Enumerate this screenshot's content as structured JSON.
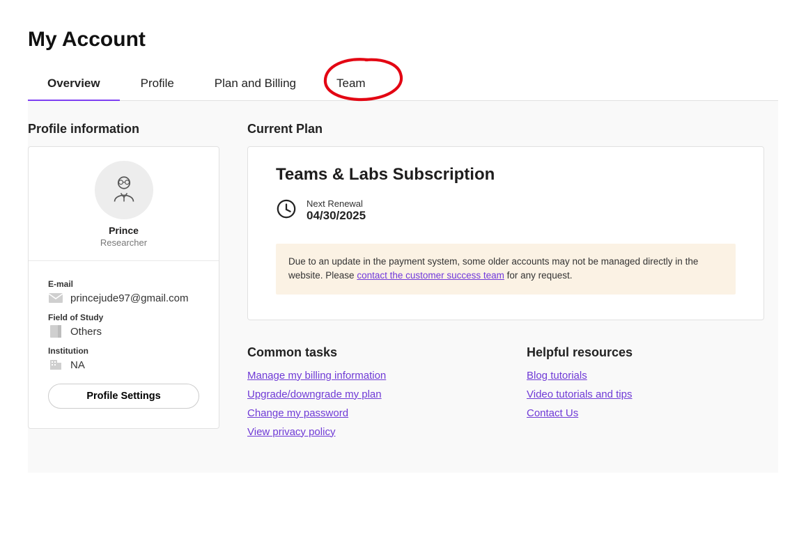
{
  "page_title": "My Account",
  "tabs": [
    {
      "label": "Overview",
      "active": true
    },
    {
      "label": "Profile",
      "active": false
    },
    {
      "label": "Plan and Billing",
      "active": false
    },
    {
      "label": "Team",
      "active": false
    }
  ],
  "profile_info": {
    "section_title": "Profile information",
    "name": "Prince",
    "role": "Researcher",
    "email_label": "E-mail",
    "email": "princejude97@gmail.com",
    "field_label": "Field of Study",
    "field_value": "Others",
    "institution_label": "Institution",
    "institution_value": "NA",
    "settings_button": "Profile Settings"
  },
  "current_plan": {
    "section_title": "Current Plan",
    "plan_name": "Teams & Labs Subscription",
    "renewal_label": "Next Renewal",
    "renewal_date": "04/30/2025",
    "alert_text_before": "Due to an update in the payment system, some older accounts may not be managed directly in the website. Please ",
    "alert_link": "contact the customer success team",
    "alert_text_after": " for any request."
  },
  "common_tasks": {
    "title": "Common tasks",
    "links": [
      "Manage my billing information",
      "Upgrade/downgrade my plan",
      "Change my password",
      "View privacy policy"
    ]
  },
  "helpful_resources": {
    "title": "Helpful resources",
    "links": [
      "Blog tutorials",
      "Video tutorials and tips",
      "Contact Us"
    ]
  },
  "annotation": {
    "type": "hand-drawn-circle",
    "target_tab": "Team",
    "color": "#e30613"
  }
}
